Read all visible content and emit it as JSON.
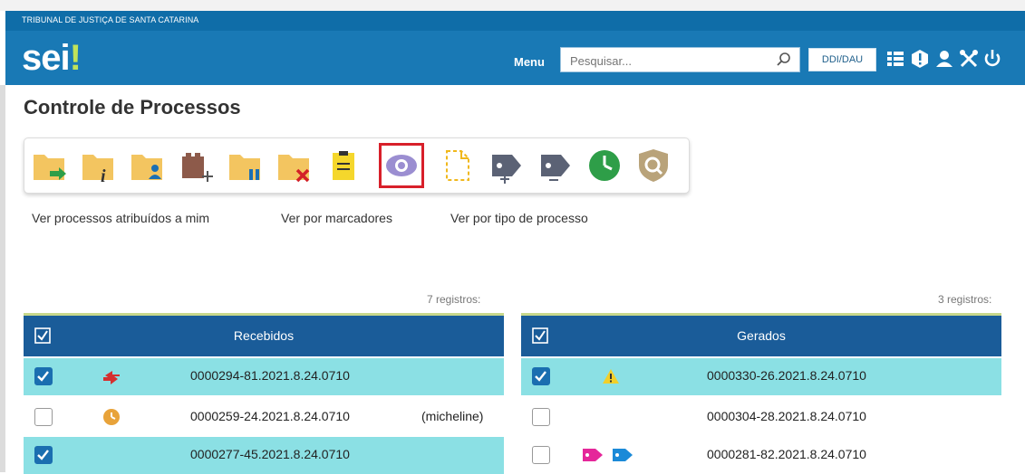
{
  "header": {
    "tribunal": "TRIBUNAL DE JUSTIÇA DE SANTA CATARINA",
    "logo_text": "sei",
    "logo_bang": "!",
    "menu_label": "Menu",
    "search_placeholder": "Pesquisar...",
    "unit_label": "DDI/DAU",
    "icons": [
      "grid-icon",
      "alert-icon",
      "user-icon",
      "tools-icon",
      "power-icon"
    ]
  },
  "page": {
    "title": "Controle de Processos"
  },
  "toolbar": {
    "tools": [
      "new-process-folder",
      "process-info-folder",
      "assign-user-folder",
      "add-block-folder",
      "suspend-folder",
      "close-folder",
      "document-note",
      "view-eye",
      "dashed-document",
      "add-tag",
      "remove-tag",
      "clock",
      "search-shield"
    ],
    "highlighted": "view-eye"
  },
  "links": [
    "Ver processos atribuídos a mim",
    "Ver por marcadores",
    "Ver por tipo de processo"
  ],
  "received": {
    "count": "7 registros:",
    "header": "Recebidos",
    "rows": [
      {
        "number": "0000294-81.2021.8.24.0710",
        "user": "",
        "checked": true,
        "icon": "transfer-arrows-icon"
      },
      {
        "number": "0000259-24.2021.8.24.0710",
        "user": "(micheline)",
        "checked": false,
        "icon": "clock-icon"
      },
      {
        "number": "0000277-45.2021.8.24.0710",
        "user": "",
        "checked": true,
        "icon": ""
      }
    ]
  },
  "generated": {
    "count": "3 registros:",
    "header": "Gerados",
    "rows": [
      {
        "number": "0000330-26.2021.8.24.0710",
        "checked": true,
        "icon": "warning-icon"
      },
      {
        "number": "0000304-28.2021.8.24.0710",
        "checked": false,
        "icon": ""
      },
      {
        "number": "0000281-82.2021.8.24.0710",
        "checked": false,
        "icon": "tags-icon"
      }
    ]
  },
  "colors": {
    "header_bg": "#1979b5",
    "table_head": "#1a5c99",
    "selected_row": "#8be0e4",
    "highlight": "#d8202a"
  }
}
